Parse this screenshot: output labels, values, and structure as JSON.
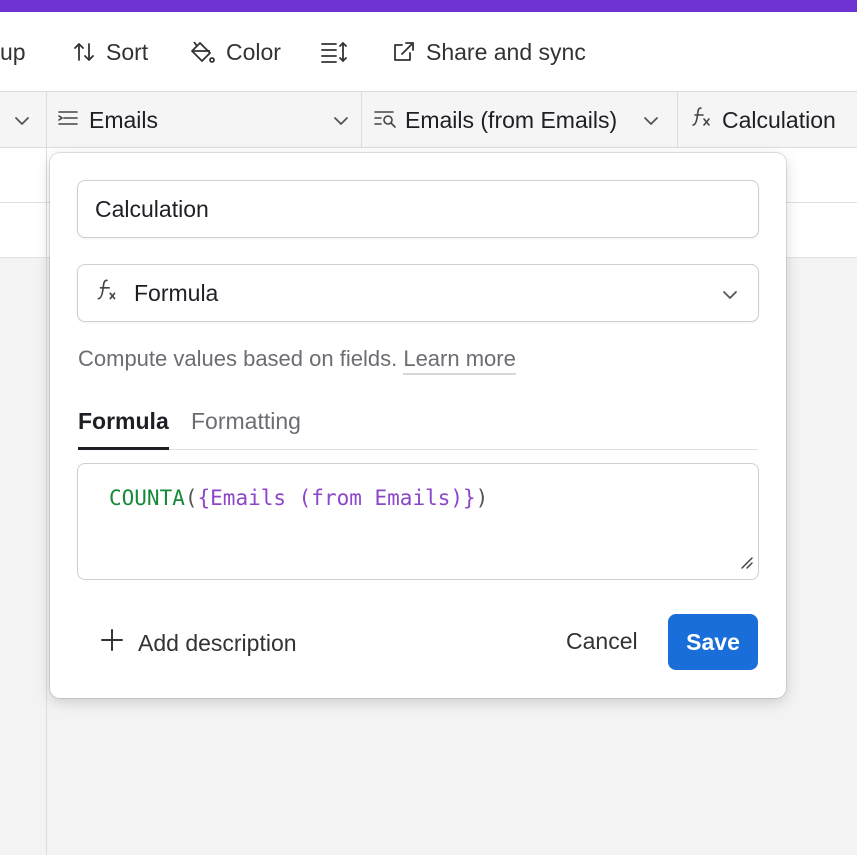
{
  "toolbar": {
    "group_label": "up",
    "sort_label": "Sort",
    "color_label": "Color",
    "row_height_icon": "row-height-icon",
    "share_label": "Share and sync"
  },
  "columns": [
    {
      "label": "Emails",
      "icon": "long-text-icon"
    },
    {
      "label": "Emails (from Emails)",
      "icon": "lookup-icon"
    },
    {
      "label": "Calculation",
      "icon": "formula-icon"
    }
  ],
  "dialog": {
    "field_name": "Calculation",
    "field_type": "Formula",
    "description": "Compute values based on fields.",
    "learn_more": "Learn more",
    "tabs": [
      {
        "label": "Formula",
        "active": true
      },
      {
        "label": "Formatting",
        "active": false
      }
    ],
    "formula": {
      "function": "COUNTA",
      "open_paren": "(",
      "reference": "{Emails (from Emails)}",
      "close_paren": ")"
    },
    "add_description": "Add description",
    "cancel": "Cancel",
    "save": "Save"
  },
  "colors": {
    "top_bar": "#6e33d3",
    "save_button": "#1a6ed9",
    "formula_function": "#178a3a",
    "formula_reference": "#8b46c9"
  }
}
